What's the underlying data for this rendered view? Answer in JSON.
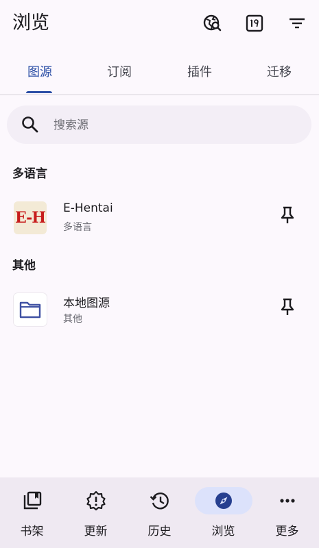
{
  "app": {
    "title": "浏览"
  },
  "tabs": [
    {
      "label": "图源"
    },
    {
      "label": "订阅"
    },
    {
      "label": "插件"
    },
    {
      "label": "迁移"
    }
  ],
  "search": {
    "placeholder": "搜索源",
    "value": ""
  },
  "sections": [
    {
      "header": "多语言",
      "items": [
        {
          "name": "E-Hentai",
          "lang": "多语言",
          "icon": "e-hentai-logo"
        }
      ]
    },
    {
      "header": "其他",
      "items": [
        {
          "name": "本地图源",
          "lang": "其他",
          "icon": "folder-icon"
        }
      ]
    }
  ],
  "icon_logo_text": "E-H",
  "nav": [
    {
      "label": "书架",
      "icon": "library-icon"
    },
    {
      "label": "更新",
      "icon": "updates-alert-icon"
    },
    {
      "label": "历史",
      "icon": "history-icon"
    },
    {
      "label": "浏览",
      "icon": "explore-icon"
    },
    {
      "label": "更多",
      "icon": "more-icon"
    }
  ],
  "colors": {
    "accent": "#2c4fa6",
    "nav_active_bg": "#dce2fb",
    "background": "#fcf8fd"
  }
}
